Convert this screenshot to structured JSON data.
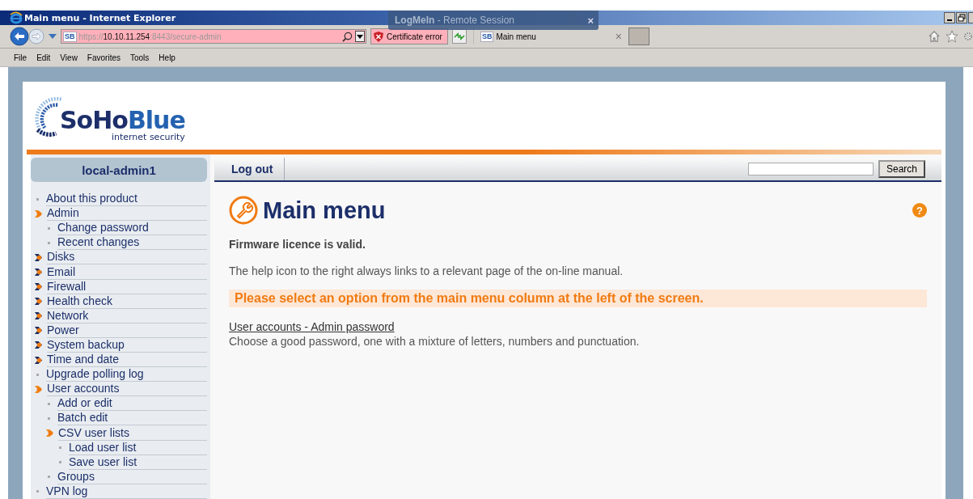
{
  "window": {
    "title": "Main menu - Internet Explorer"
  },
  "overlay": {
    "brand": "LogMeIn",
    "label": "- Remote Session",
    "close": "×"
  },
  "address_bar": {
    "favicon": "SB",
    "url_parts": [
      {
        "text": "https://",
        "kind": "dim"
      },
      {
        "text": "10.10.11.254",
        "kind": "host"
      },
      {
        "text": ":8443/secure-admin",
        "kind": "dim"
      }
    ],
    "certificate": "Certificate error"
  },
  "tabs": [
    {
      "favicon": "SB",
      "label": "Main menu",
      "selected": true,
      "close": "×"
    }
  ],
  "menu_bar": [
    "File",
    "Edit",
    "View",
    "Favorites",
    "Tools",
    "Help"
  ],
  "logo": {
    "name_dark": "SoHo",
    "name_light": "Blue",
    "tagline": "internet security"
  },
  "user": "local-admin1",
  "nav": {
    "logout": "Log out",
    "search_button": "Search"
  },
  "sidebar": {
    "items": [
      {
        "label": "About this product",
        "kind": "leaf"
      },
      {
        "label": "Admin",
        "kind": "folder",
        "expanded": true,
        "children": [
          {
            "label": "Change password",
            "kind": "leaf"
          },
          {
            "label": "Recent changes",
            "kind": "leaf"
          }
        ]
      },
      {
        "label": "Disks",
        "kind": "folder",
        "expanded": false
      },
      {
        "label": "Email",
        "kind": "folder",
        "expanded": false
      },
      {
        "label": "Firewall",
        "kind": "folder",
        "expanded": false
      },
      {
        "label": "Health check",
        "kind": "folder",
        "expanded": false
      },
      {
        "label": "Network",
        "kind": "folder",
        "expanded": false
      },
      {
        "label": "Power",
        "kind": "folder",
        "expanded": false
      },
      {
        "label": "System backup",
        "kind": "folder",
        "expanded": false
      },
      {
        "label": "Time and date",
        "kind": "folder",
        "expanded": false
      },
      {
        "label": "Upgrade polling log",
        "kind": "leaf"
      },
      {
        "label": "User accounts",
        "kind": "folder",
        "expanded": true,
        "children": [
          {
            "label": "Add or edit",
            "kind": "leaf"
          },
          {
            "label": "Batch edit",
            "kind": "leaf"
          },
          {
            "label": "CSV user lists",
            "kind": "folder",
            "expanded": true,
            "children": [
              {
                "label": "Load user list",
                "kind": "leaf"
              },
              {
                "label": "Save user list",
                "kind": "leaf"
              }
            ]
          },
          {
            "label": "Groups",
            "kind": "leaf"
          }
        ]
      },
      {
        "label": "VPN log",
        "kind": "leaf"
      }
    ]
  },
  "content": {
    "title": "Main menu",
    "help": "?",
    "status": "Firmware licence is valid.",
    "hint": "The help icon to the right always links to a relevant page of the on-line manual.",
    "notice": "Please select an option from the main menu column at the left of the screen.",
    "link": "User accounts - Admin password",
    "description": "Choose a good password, one with a mixture of letters, numbers and punctuation."
  }
}
